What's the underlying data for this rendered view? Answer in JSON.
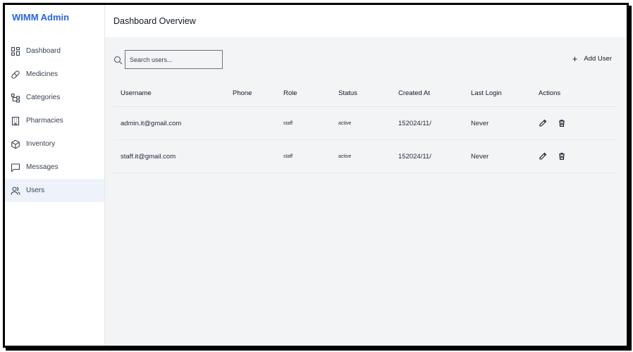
{
  "app": {
    "brand": "WIMM Admin",
    "page_title": "Dashboard Overview"
  },
  "sidebar": {
    "items": [
      {
        "label": "Dashboard",
        "icon": "dashboard-icon",
        "active": false
      },
      {
        "label": "Medicines",
        "icon": "pill-icon",
        "active": false
      },
      {
        "label": "Categories",
        "icon": "hierarchy-icon",
        "active": false
      },
      {
        "label": "Pharmacies",
        "icon": "building-icon",
        "active": false
      },
      {
        "label": "Inventory",
        "icon": "package-icon",
        "active": false
      },
      {
        "label": "Messages",
        "icon": "message-icon",
        "active": false
      },
      {
        "label": "Users",
        "icon": "users-icon",
        "active": true
      }
    ]
  },
  "toolbar": {
    "search_placeholder": "Search users...",
    "add_user_label": "Add User"
  },
  "table": {
    "columns": [
      "Username",
      "Phone",
      "Role",
      "Status",
      "Created At",
      "Last Login",
      "Actions"
    ],
    "rows": [
      {
        "username": "admin.it@gmail.com",
        "phone": "",
        "role": "staff",
        "status": "active",
        "created_at": "152024/11/",
        "last_login": "Never"
      },
      {
        "username": "staff.it@gmail.com",
        "phone": "",
        "role": "staff",
        "status": "active",
        "created_at": "152024/11/",
        "last_login": "Never"
      }
    ]
  }
}
